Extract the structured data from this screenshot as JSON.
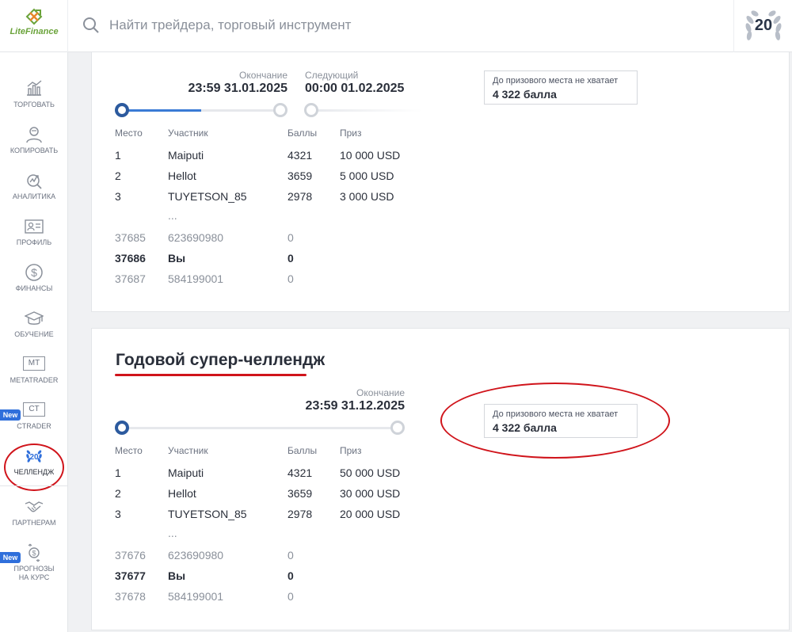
{
  "header": {
    "logo_text": "LiteFinance",
    "search_placeholder": "Найти трейдера, торговый инструмент",
    "anniversary_badge": "20"
  },
  "sidebar": {
    "items": [
      {
        "label": "ТОРГОВАТЬ",
        "icon": "chart-icon"
      },
      {
        "label": "КОПИРОВАТЬ",
        "icon": "user-icon"
      },
      {
        "label": "АНАЛИТИКА",
        "icon": "analytics-icon"
      },
      {
        "label": "ПРОФИЛЬ",
        "icon": "id-card-icon"
      },
      {
        "label": "ФИНАНСЫ",
        "icon": "dollar-icon"
      },
      {
        "label": "ОБУЧЕНИЕ",
        "icon": "graduation-cap-icon"
      },
      {
        "label": "METATRADER",
        "icon": "mt-icon",
        "box_text": "MT"
      },
      {
        "label": "CTRADER",
        "icon": "ct-icon",
        "box_text": "CT",
        "badge": "New"
      },
      {
        "label": "ЧЕЛЛЕНДЖ",
        "icon": "laurel-20-icon",
        "badge_number": "20",
        "active": true
      },
      {
        "label": "ПАРТНЕРАМ",
        "icon": "handshake-icon"
      },
      {
        "label": "ПРОГНОЗЫ НА КУРС",
        "icon": "forecast-icon",
        "badge": "New"
      }
    ]
  },
  "challenge1": {
    "end_label": "Окончание",
    "end_value": "23:59 31.01.2025",
    "next_label": "Следующий",
    "next_value": "00:00 01.02.2025",
    "progress": 0.5,
    "columns": [
      "Место",
      "Участник",
      "Баллы",
      "Приз"
    ],
    "top_rows": [
      {
        "place": "1",
        "name": "Maiputi",
        "points": "4321",
        "prize": "10 000 USD"
      },
      {
        "place": "2",
        "name": "Hellot",
        "points": "3659",
        "prize": "5 000 USD"
      },
      {
        "place": "3",
        "name": "TUYETSON_85",
        "points": "2978",
        "prize": "3 000 USD"
      }
    ],
    "ellipsis": "...",
    "near_rows": [
      {
        "place": "37685",
        "name": "623690980",
        "points": "0"
      },
      {
        "place": "37686",
        "name": "Вы",
        "points": "0",
        "is_you": true
      },
      {
        "place": "37687",
        "name": "584199001",
        "points": "0"
      }
    ],
    "need_label": "До призового места не хватает",
    "need_value": "4 322 балла"
  },
  "challenge2": {
    "title": "Годовой супер-челлендж",
    "end_label": "Окончание",
    "end_value": "23:59 31.12.2025",
    "progress": 0.0,
    "columns": [
      "Место",
      "Участник",
      "Баллы",
      "Приз"
    ],
    "top_rows": [
      {
        "place": "1",
        "name": "Maiputi",
        "points": "4321",
        "prize": "50 000 USD"
      },
      {
        "place": "2",
        "name": "Hellot",
        "points": "3659",
        "prize": "30 000 USD"
      },
      {
        "place": "3",
        "name": "TUYETSON_85",
        "points": "2978",
        "prize": "20 000 USD"
      }
    ],
    "ellipsis": "...",
    "near_rows": [
      {
        "place": "37676",
        "name": "623690980",
        "points": "0"
      },
      {
        "place": "37677",
        "name": "Вы",
        "points": "0",
        "is_you": true
      },
      {
        "place": "37678",
        "name": "584199001",
        "points": "0"
      }
    ],
    "need_label": "До призового места не хватает",
    "need_value": "4 322 балла"
  },
  "colors": {
    "accent_blue": "#3a7bd5",
    "active_dot": "#2c5a9e",
    "highlight_red": "#d0141b",
    "new_badge": "#2f6fdb",
    "logo_green": "#6aa33a"
  }
}
